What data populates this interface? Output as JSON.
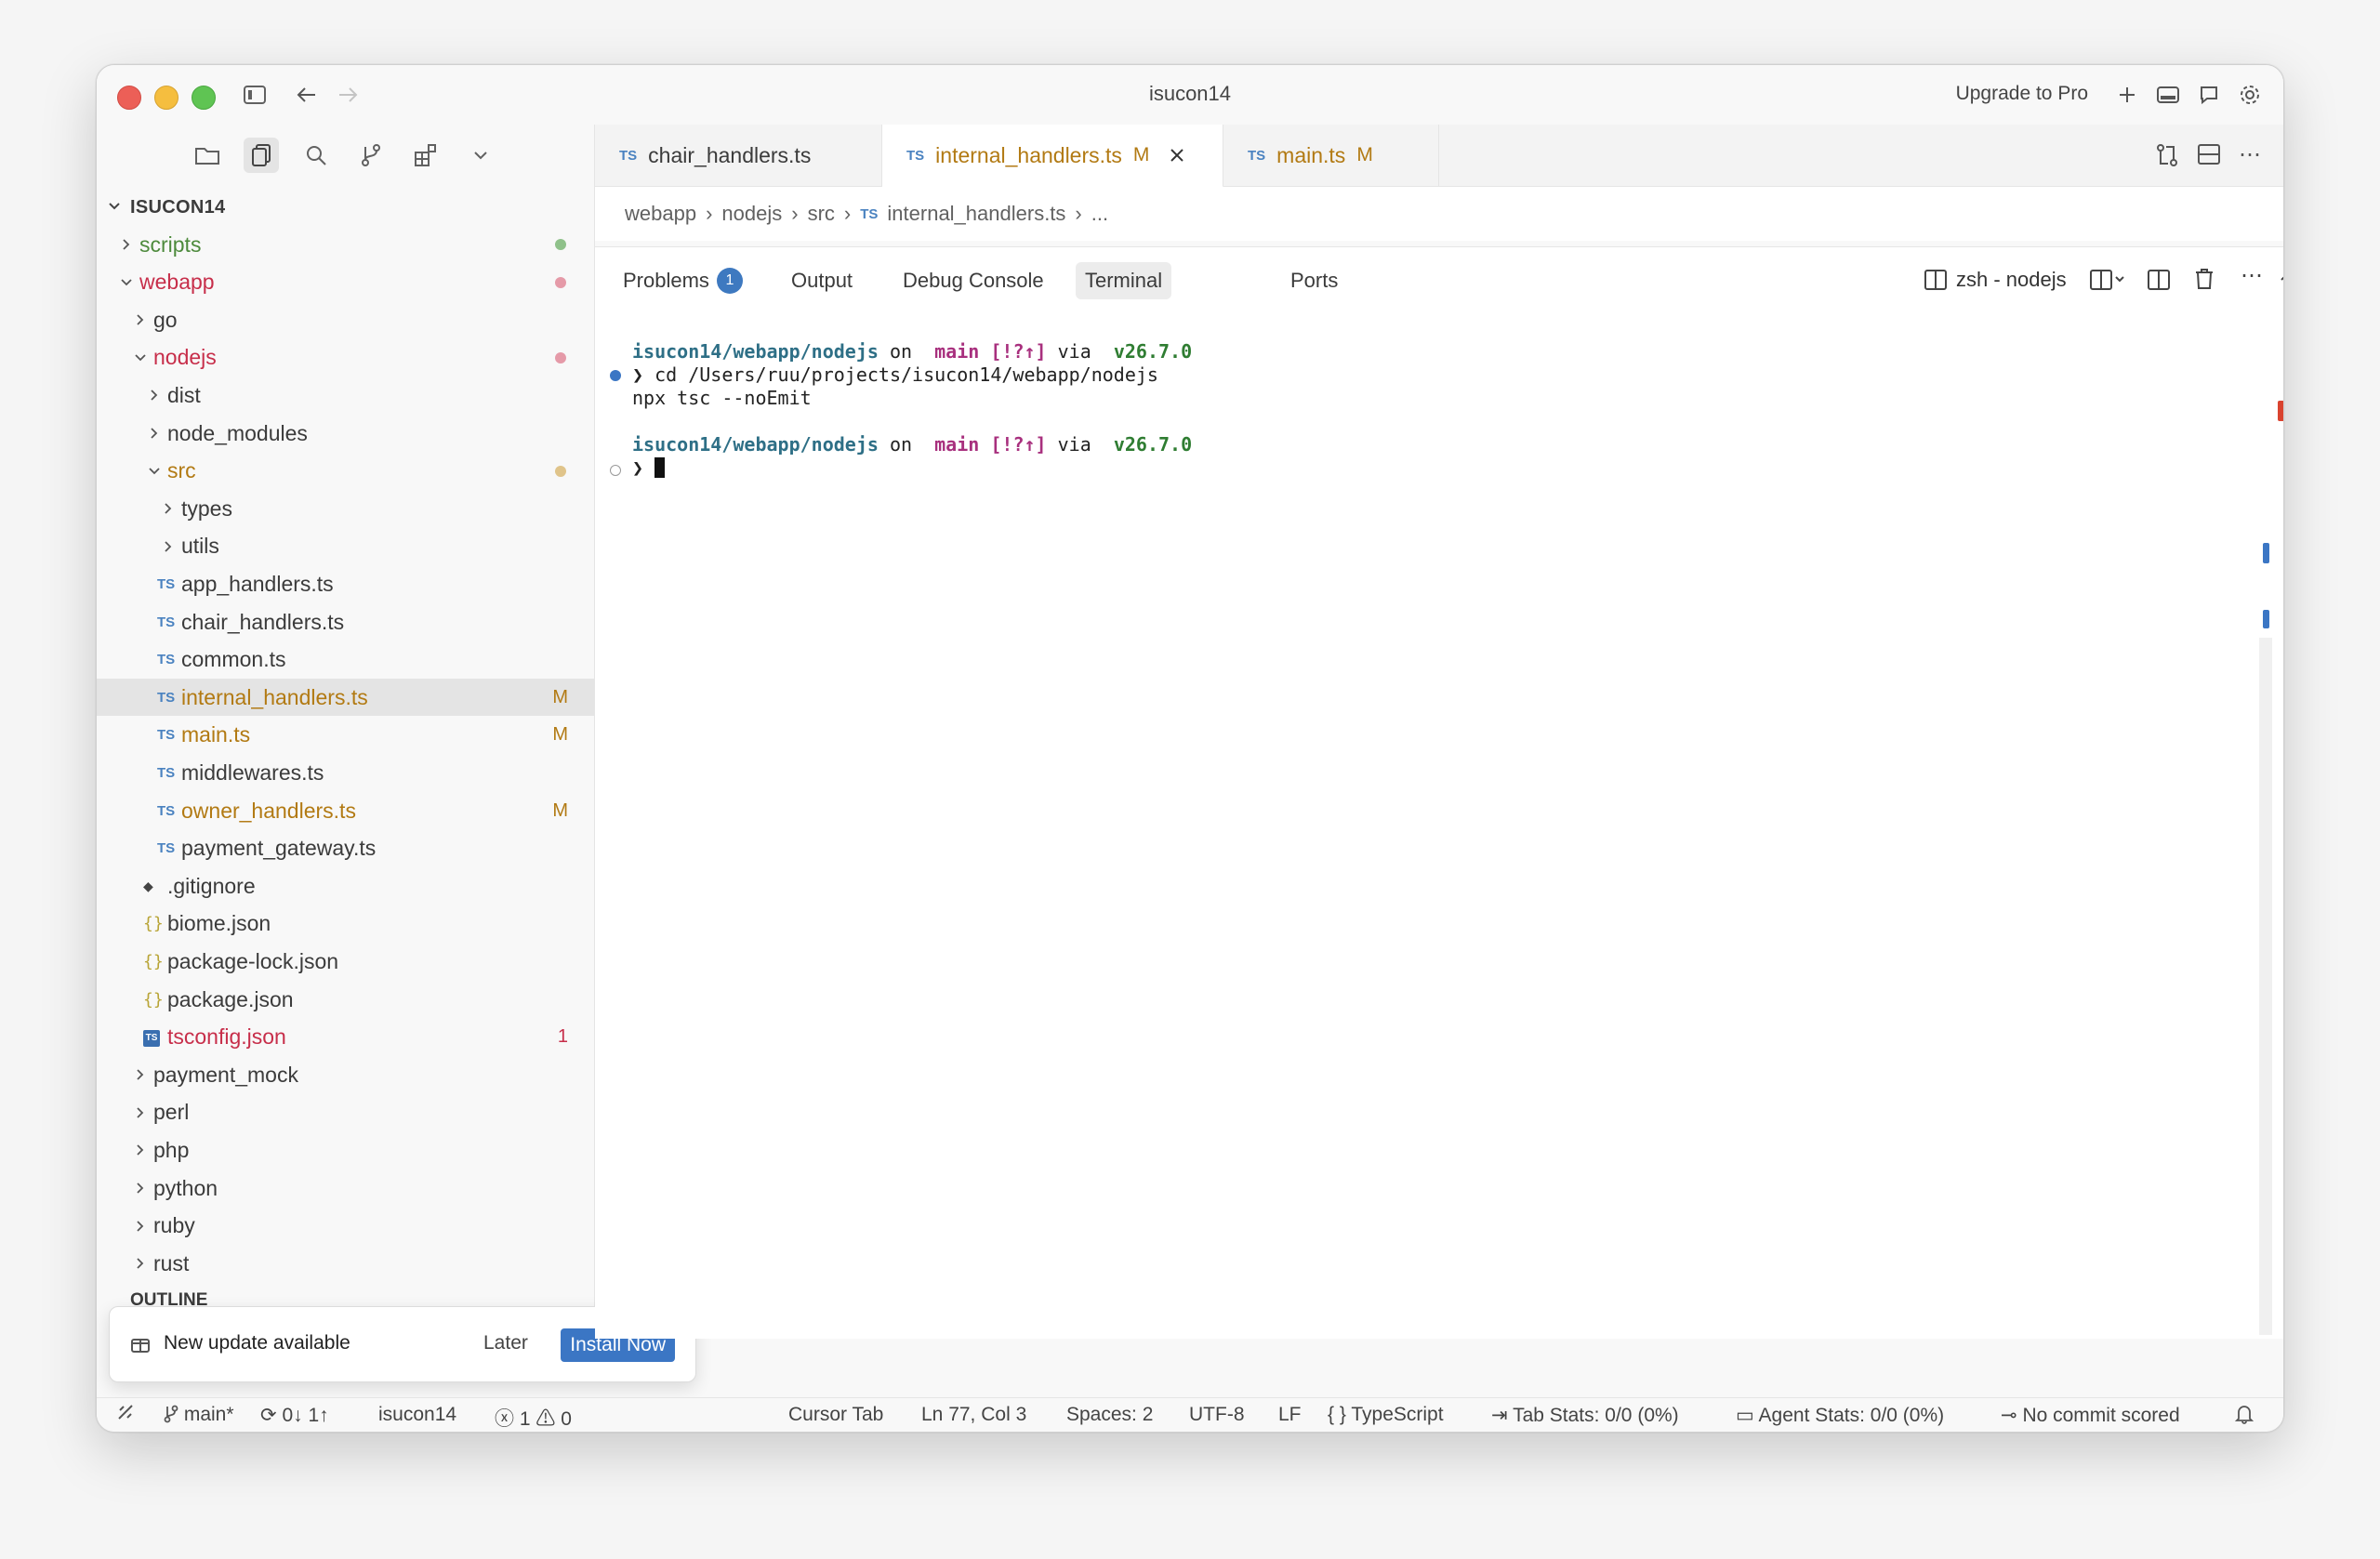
{
  "window": {
    "title": "isucon14",
    "upgrade_label": "Upgrade to Pro"
  },
  "explorer": {
    "root": "ISUCON14",
    "items": [
      {
        "label": "scripts",
        "kind": "folder-closed",
        "depth": 0,
        "status": "dot-green"
      },
      {
        "label": "webapp",
        "kind": "folder-open",
        "depth": 0,
        "status": "dot-red"
      },
      {
        "label": "go",
        "kind": "folder-closed",
        "depth": 1
      },
      {
        "label": "nodejs",
        "kind": "folder-open",
        "depth": 1,
        "status": "dot-red"
      },
      {
        "label": "dist",
        "kind": "folder-closed",
        "depth": 2
      },
      {
        "label": "node_modules",
        "kind": "folder-closed",
        "depth": 2
      },
      {
        "label": "src",
        "kind": "folder-open",
        "depth": 2,
        "status": "dot-yellow"
      },
      {
        "label": "types",
        "kind": "folder-closed",
        "depth": 3
      },
      {
        "label": "utils",
        "kind": "folder-closed",
        "depth": 3
      },
      {
        "label": "app_handlers.ts",
        "kind": "ts",
        "depth": 3
      },
      {
        "label": "chair_handlers.ts",
        "kind": "ts",
        "depth": 3
      },
      {
        "label": "common.ts",
        "kind": "ts",
        "depth": 3
      },
      {
        "label": "internal_handlers.ts",
        "kind": "ts",
        "depth": 3,
        "badge": "M",
        "selected": true
      },
      {
        "label": "main.ts",
        "kind": "ts",
        "depth": 3,
        "badge": "M"
      },
      {
        "label": "middlewares.ts",
        "kind": "ts",
        "depth": 3
      },
      {
        "label": "owner_handlers.ts",
        "kind": "ts",
        "depth": 3,
        "badge": "M"
      },
      {
        "label": "payment_gateway.ts",
        "kind": "ts",
        "depth": 3
      },
      {
        "label": ".gitignore",
        "kind": "git",
        "depth": 2
      },
      {
        "label": "biome.json",
        "kind": "json",
        "depth": 2
      },
      {
        "label": "package-lock.json",
        "kind": "json",
        "depth": 2
      },
      {
        "label": "package.json",
        "kind": "json",
        "depth": 2
      },
      {
        "label": "tsconfig.json",
        "kind": "tsconfig",
        "depth": 2,
        "badge": "1"
      },
      {
        "label": "payment_mock",
        "kind": "folder-closed",
        "depth": 1
      },
      {
        "label": "perl",
        "kind": "folder-closed",
        "depth": 1
      },
      {
        "label": "php",
        "kind": "folder-closed",
        "depth": 1
      },
      {
        "label": "python",
        "kind": "folder-closed",
        "depth": 1
      },
      {
        "label": "ruby",
        "kind": "folder-closed",
        "depth": 1
      },
      {
        "label": "rust",
        "kind": "folder-closed",
        "depth": 1
      }
    ],
    "outline_label": "OUTLINE"
  },
  "tabs": [
    {
      "label": "chair_handlers.ts",
      "badge": ""
    },
    {
      "label": "internal_handlers.ts",
      "badge": "M"
    },
    {
      "label": "main.ts",
      "badge": "M"
    }
  ],
  "breadcrumb": [
    "webapp",
    "nodejs",
    "src",
    "internal_handlers.ts",
    "..."
  ],
  "panel": {
    "tabs": [
      "Problems",
      "Output",
      "Debug Console",
      "Terminal",
      "Ports"
    ],
    "problems_count": "1",
    "terminal_name": "zsh - nodejs"
  },
  "terminal": {
    "prompt_path": "isucon14/webapp/nodejs",
    "on": "on",
    "branch_icon": "",
    "branch": "main",
    "git_status": "[!?↑]",
    "via": "via",
    "node_icon": "",
    "version": "v26.7.0",
    "prompt_char": "❯",
    "cmd_line1": "cd /Users/ruu/projects/isucon14/webapp/nodejs",
    "cmd_line2": "npx tsc --noEmit"
  },
  "notification": {
    "message": "New update available",
    "later": "Later",
    "install": "Install Now"
  },
  "statusbar": {
    "branch": "main*",
    "sync": "0↓ 1↑",
    "project": "isucon14",
    "errors": "1",
    "warnings": "0",
    "cursor_tab": "Cursor Tab",
    "position": "Ln 77, Col 3",
    "spaces": "Spaces: 2",
    "encoding": "UTF-8",
    "eol": "LF",
    "language": "TypeScript",
    "tab_stats": "Tab Stats: 0/0 (0%)",
    "agent_stats": "Agent Stats: 0/0 (0%)",
    "commit": "No commit scored"
  },
  "colors": {
    "accent": "#3b76c4",
    "modified": "#b27a13",
    "error": "#c72e4a",
    "folder_green": "#4d8a3c"
  }
}
